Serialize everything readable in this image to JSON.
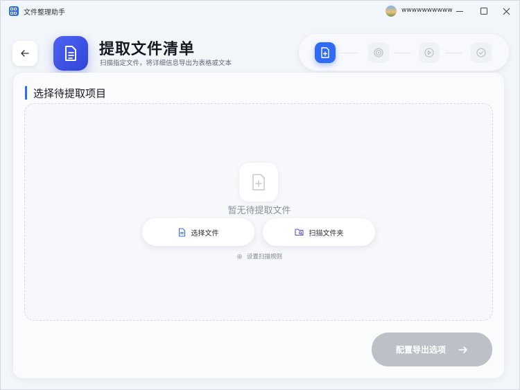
{
  "window": {
    "app_title": "文件整理助手",
    "user_name": "wwwwwwwwww"
  },
  "header": {
    "title": "提取文件清单",
    "subtitle": "扫描指定文件，将详细信息导出为表格或文本"
  },
  "stepper": {
    "active_step": 1,
    "steps": [
      "file-add-icon",
      "target-icon",
      "play-icon",
      "check-icon"
    ]
  },
  "section": {
    "title": "选择待提取项目"
  },
  "dropzone": {
    "empty_text": "暂无待提取文件",
    "select_file_label": "选择文件",
    "scan_folder_label": "扫描文件夹",
    "rules_link_label": "设置扫描规则"
  },
  "footer": {
    "next_label": "配置导出选项"
  },
  "colors": {
    "accent": "#2f6cf3",
    "disabled": "#bcc0c7"
  }
}
